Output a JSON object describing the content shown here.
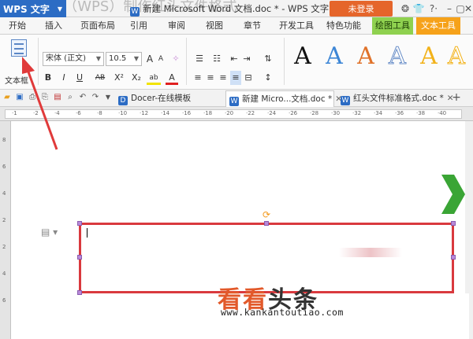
{
  "titlebar": {
    "app_name": "WPS 文字",
    "app_menu_caret": "▼",
    "doc_title": "新建 Microsoft Word 文档.doc * - WPS 文字",
    "login_label": "未登录",
    "ghost_title": "word文档（WPS）制作红头文件格式",
    "icons": [
      "skin-icon",
      "shirt-icon",
      "help-icon",
      "minimize-icon",
      "restore-icon",
      "close-icon"
    ],
    "help_label": "?",
    "icon_glyphs": [
      "❂",
      "👕",
      "?·",
      "–",
      "▢",
      "✕"
    ]
  },
  "menu": {
    "tabs": [
      "开始",
      "插入",
      "页面布局",
      "引用",
      "审阅",
      "视图",
      "章节",
      "开发工具",
      "特色功能",
      "绘图工具",
      "文本工具"
    ]
  },
  "ribbon": {
    "textbox_label": "文本框",
    "font_name": "宋体 (正文)",
    "font_size": "10.5",
    "bold": "B",
    "italic": "I",
    "underline": "U",
    "strike": "AB",
    "superscript": "X²",
    "subscript": "X₂",
    "font_color": "A",
    "grow_font": "A",
    "shrink_font": "A",
    "highlight": "ab",
    "styles_preview": [
      "A",
      "A",
      "A",
      "A",
      "A"
    ],
    "style_colors": [
      "#111111",
      "#3d86d6",
      "#e0722a",
      "#b7c9e6",
      "#f2b21a"
    ]
  },
  "doctabs": {
    "quick_icons": [
      "open-icon",
      "save-icon",
      "print-icon",
      "print-preview-icon",
      "export-pdf-icon",
      "undo-icon",
      "redo-icon"
    ],
    "tabs": [
      {
        "label": "Docer-在线模板",
        "icon": "D"
      },
      {
        "label": "新建 Micro...文档.doc *",
        "icon": "W",
        "close": "✕"
      },
      {
        "label": "红头文件标准格式.doc *",
        "icon": "W",
        "close": "✕"
      }
    ],
    "new_tab": "+"
  },
  "ruler": {
    "marks": [
      "1",
      "2",
      "4",
      "6",
      "8",
      "10",
      "12",
      "14",
      "16",
      "18",
      "20",
      "22",
      "24",
      "26",
      "28",
      "30",
      "32",
      "34",
      "36",
      "38",
      "40"
    ]
  },
  "vruler": {
    "marks": [
      "8",
      "6",
      "4",
      "2",
      "2",
      "4",
      "6"
    ]
  },
  "document": {
    "rotate_glyph": "⟳",
    "doc_icon": "▤ ▾"
  },
  "watermark": {
    "cn_part1": "看看",
    "cn_part2": "头条",
    "url": "www.kankantoutiao.com"
  },
  "colors": {
    "textbox_border": "#d9393e",
    "app_blue": "#2c6cc4",
    "login_orange": "#e5652b",
    "drawing_tools_tab": "#8fd14f",
    "text_tools_tab": "#f6a21a",
    "annotation_arrow": "#e03a3a",
    "nav_arrow": "#3aa535"
  }
}
